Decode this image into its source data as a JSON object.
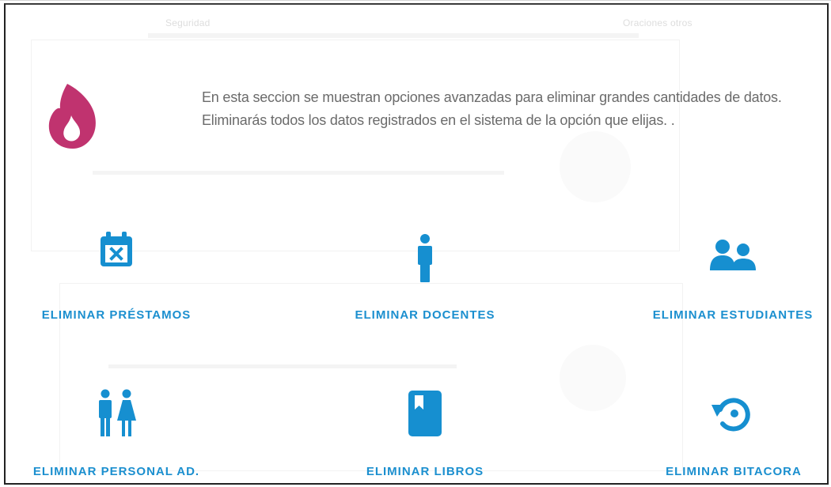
{
  "background": {
    "left_caption": "Seguridad",
    "right_caption": "Oraciones otros"
  },
  "intro": {
    "icon": "fire-icon",
    "text": "En esta seccion se muestran opciones avanzadas para eliminar grandes cantidades de datos. Eliminarás todos los datos registrados en el sistema de la opción que elijas. ."
  },
  "options": [
    {
      "label": "ELIMINAR PRÉSTAMOS",
      "icon": "calendar-x-icon"
    },
    {
      "label": "ELIMINAR DOCENTES",
      "icon": "person-icon"
    },
    {
      "label": "ELIMINAR ESTUDIANTES",
      "icon": "group-icon"
    },
    {
      "label": "ELIMINAR PERSONAL AD.",
      "icon": "wc-icon"
    },
    {
      "label": "ELIMINAR LIBROS",
      "icon": "book-icon"
    },
    {
      "label": "ELIMINAR BITACORA",
      "icon": "restore-icon"
    }
  ],
  "colors": {
    "accent": "#168fd0",
    "intro_icon": "#c0336f",
    "text": "#6b6b6b",
    "frame": "#222222"
  }
}
